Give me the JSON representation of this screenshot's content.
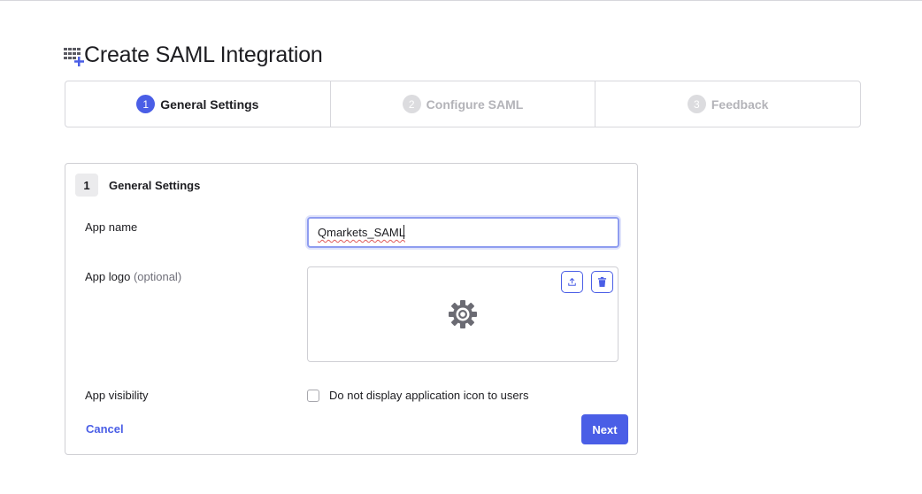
{
  "page": {
    "title": "Create SAML Integration"
  },
  "stepper": {
    "steps": [
      {
        "number": "1",
        "label": "General Settings",
        "state": "active"
      },
      {
        "number": "2",
        "label": "Configure SAML",
        "state": "inactive"
      },
      {
        "number": "3",
        "label": "Feedback",
        "state": "inactive"
      }
    ]
  },
  "card": {
    "number": "1",
    "title": "General Settings",
    "app_name": {
      "label": "App name",
      "value": "Qmarkets_SAML"
    },
    "app_logo": {
      "label": "App logo",
      "optional": "(optional)"
    },
    "app_visibility": {
      "label": "App visibility",
      "checkbox_label": "Do not display application icon to users",
      "checked": false
    },
    "cancel_label": "Cancel",
    "next_label": "Next"
  },
  "icons": {
    "title": "grid-plus-icon",
    "upload": "upload-icon",
    "delete": "trash-icon",
    "logo_placeholder": "gear-icon"
  },
  "colors": {
    "accent": "#4a5ee6",
    "inactive_step": "#b3b3b8",
    "border": "#d7d7dc"
  }
}
